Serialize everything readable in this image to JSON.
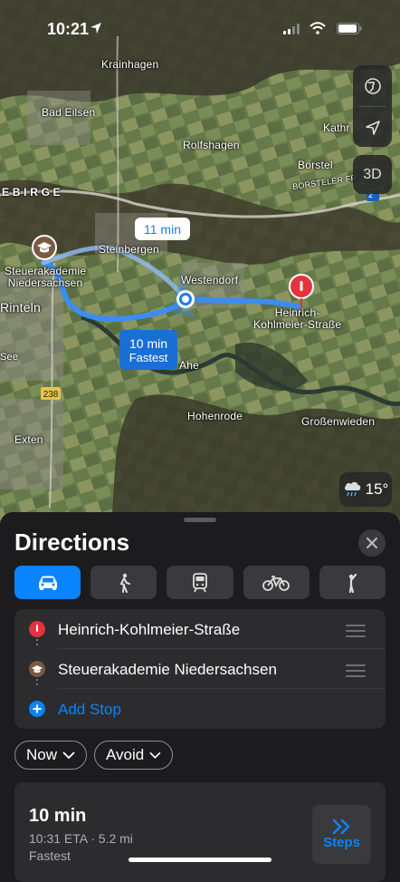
{
  "status_bar": {
    "time": "10:21"
  },
  "map": {
    "labels": {
      "krainhagen": "Krainhagen",
      "bad_eilsen": "Bad Eilsen",
      "kathrinhagen": "Kathr",
      "rolfshagen": "Rolfshagen",
      "borstel": "Borstel",
      "borsteler": "BORSTELER FR",
      "gebirge": "E B I R G E",
      "steinbergen": "Steinbergen",
      "westendorf": "Westendorf",
      "steuerakademie": "Steuerakademie\nNiedersachsen",
      "destination": "Heinrich-\nKohlmeier-Straße",
      "rinteln": "Rinteln",
      "see": "See",
      "ahe": "Ahe",
      "hohenrode": "Hohenrode",
      "grossenwieden": "Großenwieden",
      "exten": "Exten",
      "road_238": "238",
      "road_2": "2"
    },
    "callout_alt_time": "11 min",
    "callout_main_time": "10 min",
    "callout_main_sub": "Fastest",
    "btn_3d": "3D",
    "weather_temp": "15°"
  },
  "sheet": {
    "title": "Directions",
    "modes": [
      {
        "name": "drive",
        "active": true
      },
      {
        "name": "walk",
        "active": false
      },
      {
        "name": "transit",
        "active": false
      },
      {
        "name": "cycle",
        "active": false
      },
      {
        "name": "ride",
        "active": false
      }
    ],
    "stops": [
      {
        "label": "Heinrich-Kohlmeier-Straße",
        "icon": "red-pin-icon"
      },
      {
        "label": "Steuerakademie Niedersachsen",
        "icon": "graduation-cap-icon"
      }
    ],
    "add_stop": "Add Stop",
    "now_label": "Now",
    "avoid_label": "Avoid",
    "route": {
      "time": "10 min",
      "eta": "10:31 ETA · 5.2 mi",
      "tag": "Fastest",
      "steps_label": "Steps"
    }
  },
  "colors": {
    "accent": "#0a84ff",
    "route": "#3b8df0",
    "pin_red": "#e5323c"
  }
}
